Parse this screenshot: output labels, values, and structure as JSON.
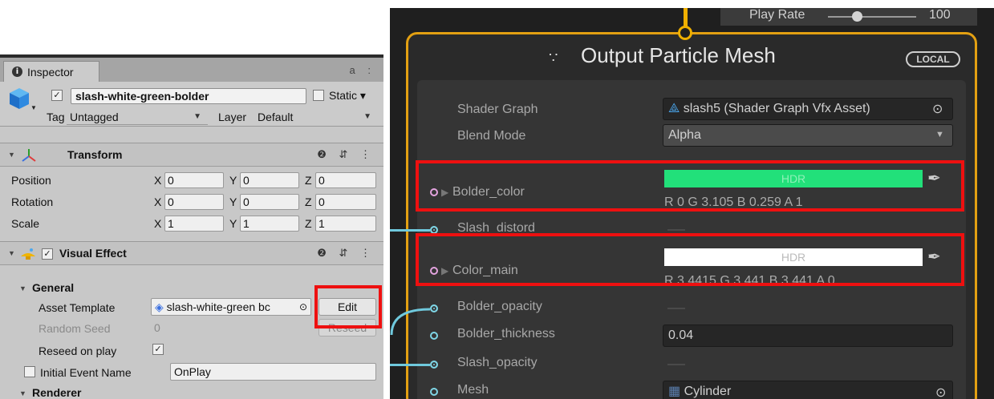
{
  "inspector": {
    "tab_label": "Inspector",
    "tab_tools": "a :",
    "object": {
      "active_check": "✓",
      "name": "slash-white-green-bolder",
      "static_label": "Static ▾",
      "tag_label": "Tag",
      "tag_value": "Untagged",
      "layer_label": "Layer",
      "layer_value": "Default"
    },
    "transform": {
      "title": "Transform",
      "tools": "❷ ⇵ ⋮",
      "rows": [
        {
          "label": "Position",
          "x": "0",
          "y": "0",
          "z": "0"
        },
        {
          "label": "Rotation",
          "x": "0",
          "y": "0",
          "z": "0"
        },
        {
          "label": "Scale",
          "x": "1",
          "y": "1",
          "z": "1"
        }
      ],
      "axis": {
        "x": "X",
        "y": "Y",
        "z": "Z"
      }
    },
    "visual_effect": {
      "enabled_check": "✓",
      "title": "Visual Effect",
      "tools": "❷ ⇵ ⋮",
      "general_label": "General",
      "asset_template_label": "Asset Template",
      "asset_template_value": "slash-white-green bc",
      "edit_label": "Edit",
      "random_seed_label": "Random Seed",
      "random_seed_value": "0",
      "reseed_label": "Reseed",
      "reseed_on_play_label": "Reseed on play",
      "reseed_check": "✓",
      "initial_event_label": "Initial Event Name",
      "initial_event_value": "OnPlay",
      "renderer_label": "Renderer"
    }
  },
  "graph": {
    "play_rate_label": "Play Rate",
    "play_rate_fraction": 0.33,
    "play_rate_value": "100",
    "context_icon": "∵",
    "context_title": "Output Particle Mesh",
    "local_badge": "LOCAL",
    "shader_graph_label": "Shader Graph",
    "shader_graph_value": "slash5 (Shader Graph Vfx Asset)",
    "blend_mode_label": "Blend Mode",
    "blend_mode_value": "Alpha",
    "bolder_color": {
      "label": "Bolder_color",
      "hdr": "HDR",
      "swatch": "#22e07a",
      "rgba": "R 0      G 3.105  B 0.259  A 1"
    },
    "slash_distord_label": "Slash_distord",
    "color_main": {
      "label": "Color_main",
      "hdr": "HDR",
      "swatch": "#ffffff",
      "rgba": "R 3.4415  G 3.441  B 3.441  A 0"
    },
    "bolder_opacity_label": "Bolder_opacity",
    "bolder_thickness_label": "Bolder_thickness",
    "bolder_thickness_value": "0.04",
    "slash_opacity_label": "Slash_opacity",
    "mesh_label": "Mesh",
    "mesh_value": "Cylinder"
  },
  "colors": {
    "highlight": "#ee1010",
    "context_border": "#e3a012",
    "port": "#7fd6e6"
  }
}
